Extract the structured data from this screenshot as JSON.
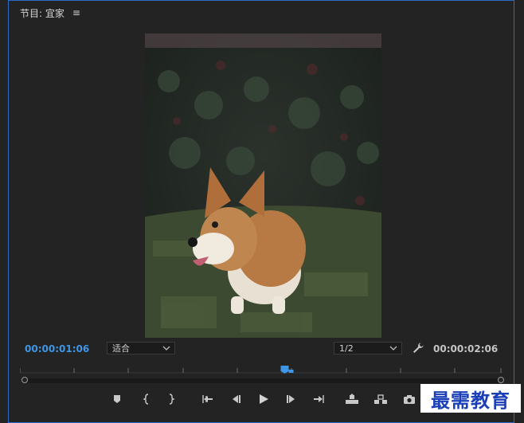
{
  "panel": {
    "title": "节目: 宜家",
    "menu_icon": "hamburger-menu-icon"
  },
  "video": {
    "subject": "corgi-dog-on-grass"
  },
  "playback": {
    "current_timecode": "00:00:01:06",
    "duration_timecode": "00:00:02:06",
    "playhead_fraction": 0.55
  },
  "zoom_select": {
    "value": "适合"
  },
  "resolution_select": {
    "value": "1/2"
  },
  "controls": [
    "add-marker-icon",
    "mark-in-icon",
    "mark-out-icon",
    "go-to-in-icon",
    "step-back-icon",
    "play-icon",
    "step-forward-icon",
    "go-to-out-icon",
    "lift-icon",
    "extract-icon",
    "export-frame-icon"
  ],
  "colors": {
    "accent": "#3f95e6",
    "panel_border": "#2d6bc9",
    "background": "#232323"
  },
  "watermark": {
    "text": "最需教育"
  }
}
